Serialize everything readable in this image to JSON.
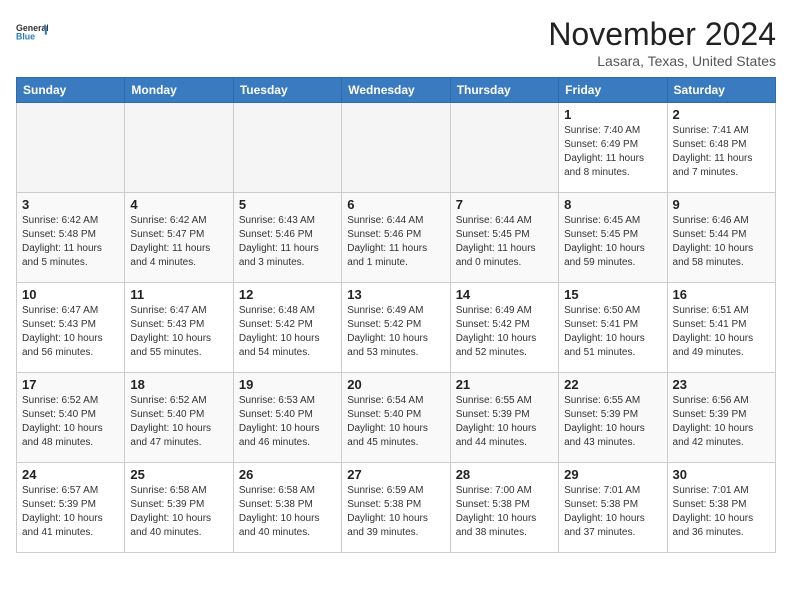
{
  "logo": {
    "general": "General",
    "blue": "Blue"
  },
  "title": "November 2024",
  "location": "Lasara, Texas, United States",
  "days_of_week": [
    "Sunday",
    "Monday",
    "Tuesday",
    "Wednesday",
    "Thursday",
    "Friday",
    "Saturday"
  ],
  "weeks": [
    [
      {
        "day": "",
        "info": ""
      },
      {
        "day": "",
        "info": ""
      },
      {
        "day": "",
        "info": ""
      },
      {
        "day": "",
        "info": ""
      },
      {
        "day": "",
        "info": ""
      },
      {
        "day": "1",
        "info": "Sunrise: 7:40 AM\nSunset: 6:49 PM\nDaylight: 11 hours\nand 8 minutes."
      },
      {
        "day": "2",
        "info": "Sunrise: 7:41 AM\nSunset: 6:48 PM\nDaylight: 11 hours\nand 7 minutes."
      }
    ],
    [
      {
        "day": "3",
        "info": "Sunrise: 6:42 AM\nSunset: 5:48 PM\nDaylight: 11 hours\nand 5 minutes."
      },
      {
        "day": "4",
        "info": "Sunrise: 6:42 AM\nSunset: 5:47 PM\nDaylight: 11 hours\nand 4 minutes."
      },
      {
        "day": "5",
        "info": "Sunrise: 6:43 AM\nSunset: 5:46 PM\nDaylight: 11 hours\nand 3 minutes."
      },
      {
        "day": "6",
        "info": "Sunrise: 6:44 AM\nSunset: 5:46 PM\nDaylight: 11 hours\nand 1 minute."
      },
      {
        "day": "7",
        "info": "Sunrise: 6:44 AM\nSunset: 5:45 PM\nDaylight: 11 hours\nand 0 minutes."
      },
      {
        "day": "8",
        "info": "Sunrise: 6:45 AM\nSunset: 5:45 PM\nDaylight: 10 hours\nand 59 minutes."
      },
      {
        "day": "9",
        "info": "Sunrise: 6:46 AM\nSunset: 5:44 PM\nDaylight: 10 hours\nand 58 minutes."
      }
    ],
    [
      {
        "day": "10",
        "info": "Sunrise: 6:47 AM\nSunset: 5:43 PM\nDaylight: 10 hours\nand 56 minutes."
      },
      {
        "day": "11",
        "info": "Sunrise: 6:47 AM\nSunset: 5:43 PM\nDaylight: 10 hours\nand 55 minutes."
      },
      {
        "day": "12",
        "info": "Sunrise: 6:48 AM\nSunset: 5:42 PM\nDaylight: 10 hours\nand 54 minutes."
      },
      {
        "day": "13",
        "info": "Sunrise: 6:49 AM\nSunset: 5:42 PM\nDaylight: 10 hours\nand 53 minutes."
      },
      {
        "day": "14",
        "info": "Sunrise: 6:49 AM\nSunset: 5:42 PM\nDaylight: 10 hours\nand 52 minutes."
      },
      {
        "day": "15",
        "info": "Sunrise: 6:50 AM\nSunset: 5:41 PM\nDaylight: 10 hours\nand 51 minutes."
      },
      {
        "day": "16",
        "info": "Sunrise: 6:51 AM\nSunset: 5:41 PM\nDaylight: 10 hours\nand 49 minutes."
      }
    ],
    [
      {
        "day": "17",
        "info": "Sunrise: 6:52 AM\nSunset: 5:40 PM\nDaylight: 10 hours\nand 48 minutes."
      },
      {
        "day": "18",
        "info": "Sunrise: 6:52 AM\nSunset: 5:40 PM\nDaylight: 10 hours\nand 47 minutes."
      },
      {
        "day": "19",
        "info": "Sunrise: 6:53 AM\nSunset: 5:40 PM\nDaylight: 10 hours\nand 46 minutes."
      },
      {
        "day": "20",
        "info": "Sunrise: 6:54 AM\nSunset: 5:40 PM\nDaylight: 10 hours\nand 45 minutes."
      },
      {
        "day": "21",
        "info": "Sunrise: 6:55 AM\nSunset: 5:39 PM\nDaylight: 10 hours\nand 44 minutes."
      },
      {
        "day": "22",
        "info": "Sunrise: 6:55 AM\nSunset: 5:39 PM\nDaylight: 10 hours\nand 43 minutes."
      },
      {
        "day": "23",
        "info": "Sunrise: 6:56 AM\nSunset: 5:39 PM\nDaylight: 10 hours\nand 42 minutes."
      }
    ],
    [
      {
        "day": "24",
        "info": "Sunrise: 6:57 AM\nSunset: 5:39 PM\nDaylight: 10 hours\nand 41 minutes."
      },
      {
        "day": "25",
        "info": "Sunrise: 6:58 AM\nSunset: 5:39 PM\nDaylight: 10 hours\nand 40 minutes."
      },
      {
        "day": "26",
        "info": "Sunrise: 6:58 AM\nSunset: 5:38 PM\nDaylight: 10 hours\nand 40 minutes."
      },
      {
        "day": "27",
        "info": "Sunrise: 6:59 AM\nSunset: 5:38 PM\nDaylight: 10 hours\nand 39 minutes."
      },
      {
        "day": "28",
        "info": "Sunrise: 7:00 AM\nSunset: 5:38 PM\nDaylight: 10 hours\nand 38 minutes."
      },
      {
        "day": "29",
        "info": "Sunrise: 7:01 AM\nSunset: 5:38 PM\nDaylight: 10 hours\nand 37 minutes."
      },
      {
        "day": "30",
        "info": "Sunrise: 7:01 AM\nSunset: 5:38 PM\nDaylight: 10 hours\nand 36 minutes."
      }
    ]
  ]
}
